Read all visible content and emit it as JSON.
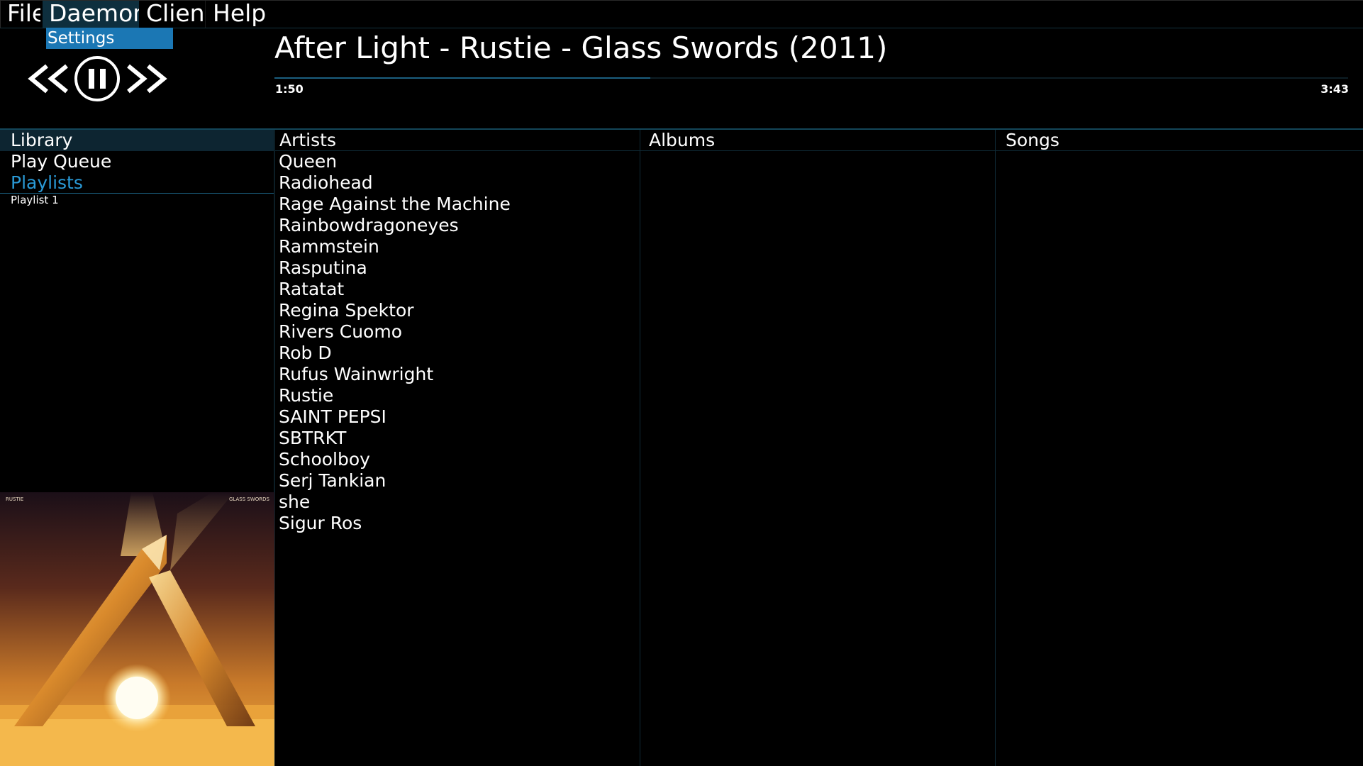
{
  "menubar": {
    "items": [
      "File",
      "Daemon",
      "Client",
      "Help"
    ],
    "open_menu": "Daemon",
    "dropdown": [
      "Settings"
    ]
  },
  "player": {
    "title": "After Light - Rustie - Glass Swords (2011)",
    "elapsed": "1:50",
    "duration": "3:43",
    "progress": 0.35,
    "state": "playing"
  },
  "sidebar": {
    "items": [
      {
        "label": "Library",
        "selected": true
      },
      {
        "label": "Play Queue"
      },
      {
        "label": "Playlists",
        "expanded": true,
        "accent": "#2a9ad7"
      }
    ],
    "playlists": [
      "Playlist 1"
    ]
  },
  "album_art": {
    "artist_text": "RUSTIE",
    "album_text": "GLASS SWORDS"
  },
  "library": {
    "columns": [
      "Artists",
      "Albums",
      "Songs"
    ],
    "artists": [
      "Queen",
      "Radiohead",
      "Rage Against the Machine",
      "Rainbowdragoneyes",
      "Rammstein",
      "Rasputina",
      "Ratatat",
      "Regina Spektor",
      "Rivers Cuomo",
      "Rob D",
      "Rufus Wainwright",
      "Rustie",
      "SAINT PEPSI",
      "SBTRKT",
      "Schoolboy",
      "Serj Tankian",
      "she",
      "Sigur Ros"
    ],
    "albums": [],
    "songs": []
  },
  "colors": {
    "accent": "#1b77b4",
    "accent_text": "#2a9ad7",
    "divider": "#144659",
    "background": "#000000"
  }
}
